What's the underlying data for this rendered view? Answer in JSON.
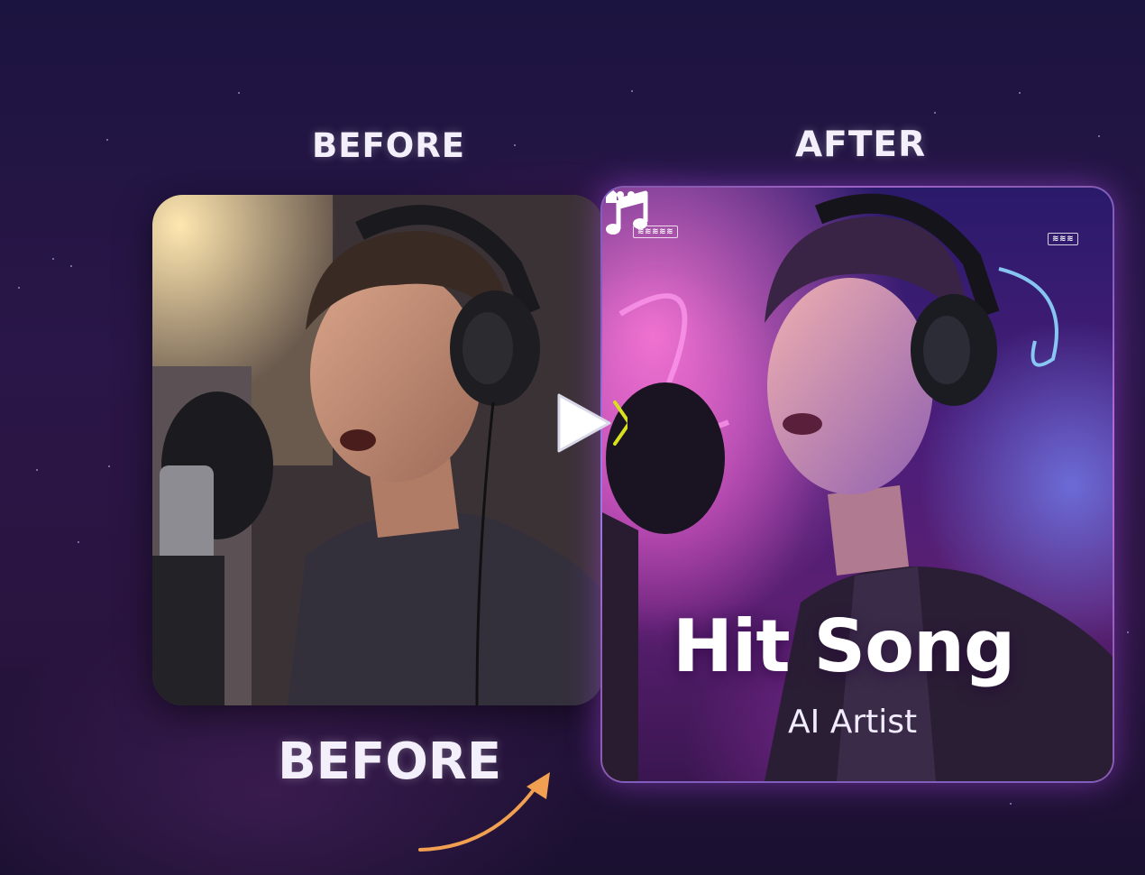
{
  "labels": {
    "before_top": "BEFORE",
    "after_top": "AFTER",
    "before_bottom": "BEFORE"
  },
  "album": {
    "title": "Hit Song",
    "artist": "AI Artist",
    "icons": [
      "music-note-icon",
      "more-options-icon",
      "home-icon"
    ]
  },
  "colors": {
    "background": "#22153f",
    "accent_glow": "#be50ff",
    "arrow": "#f0a050"
  }
}
